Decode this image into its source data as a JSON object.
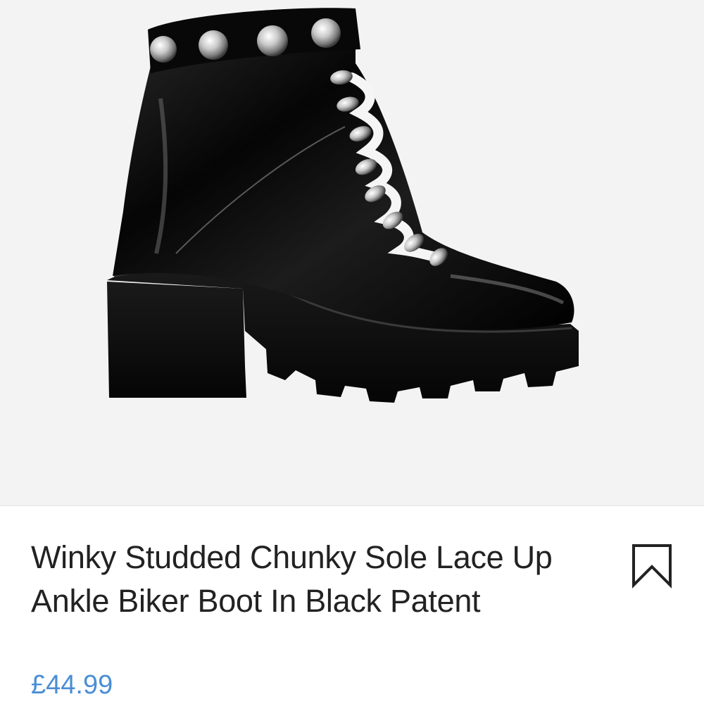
{
  "product": {
    "image_alt": "Black patent studded lace-up ankle biker boot with chunky cleated sole",
    "title": "Winky Studded Chunky Sole Lace Up Ankle Biker Boot In Black Patent",
    "price": "£44.99",
    "bookmark_icon": "bookmark-icon"
  },
  "colors": {
    "image_bg": "#f3f3f3",
    "title": "#222222",
    "price": "#4a8ed6",
    "icon": "#222222"
  }
}
